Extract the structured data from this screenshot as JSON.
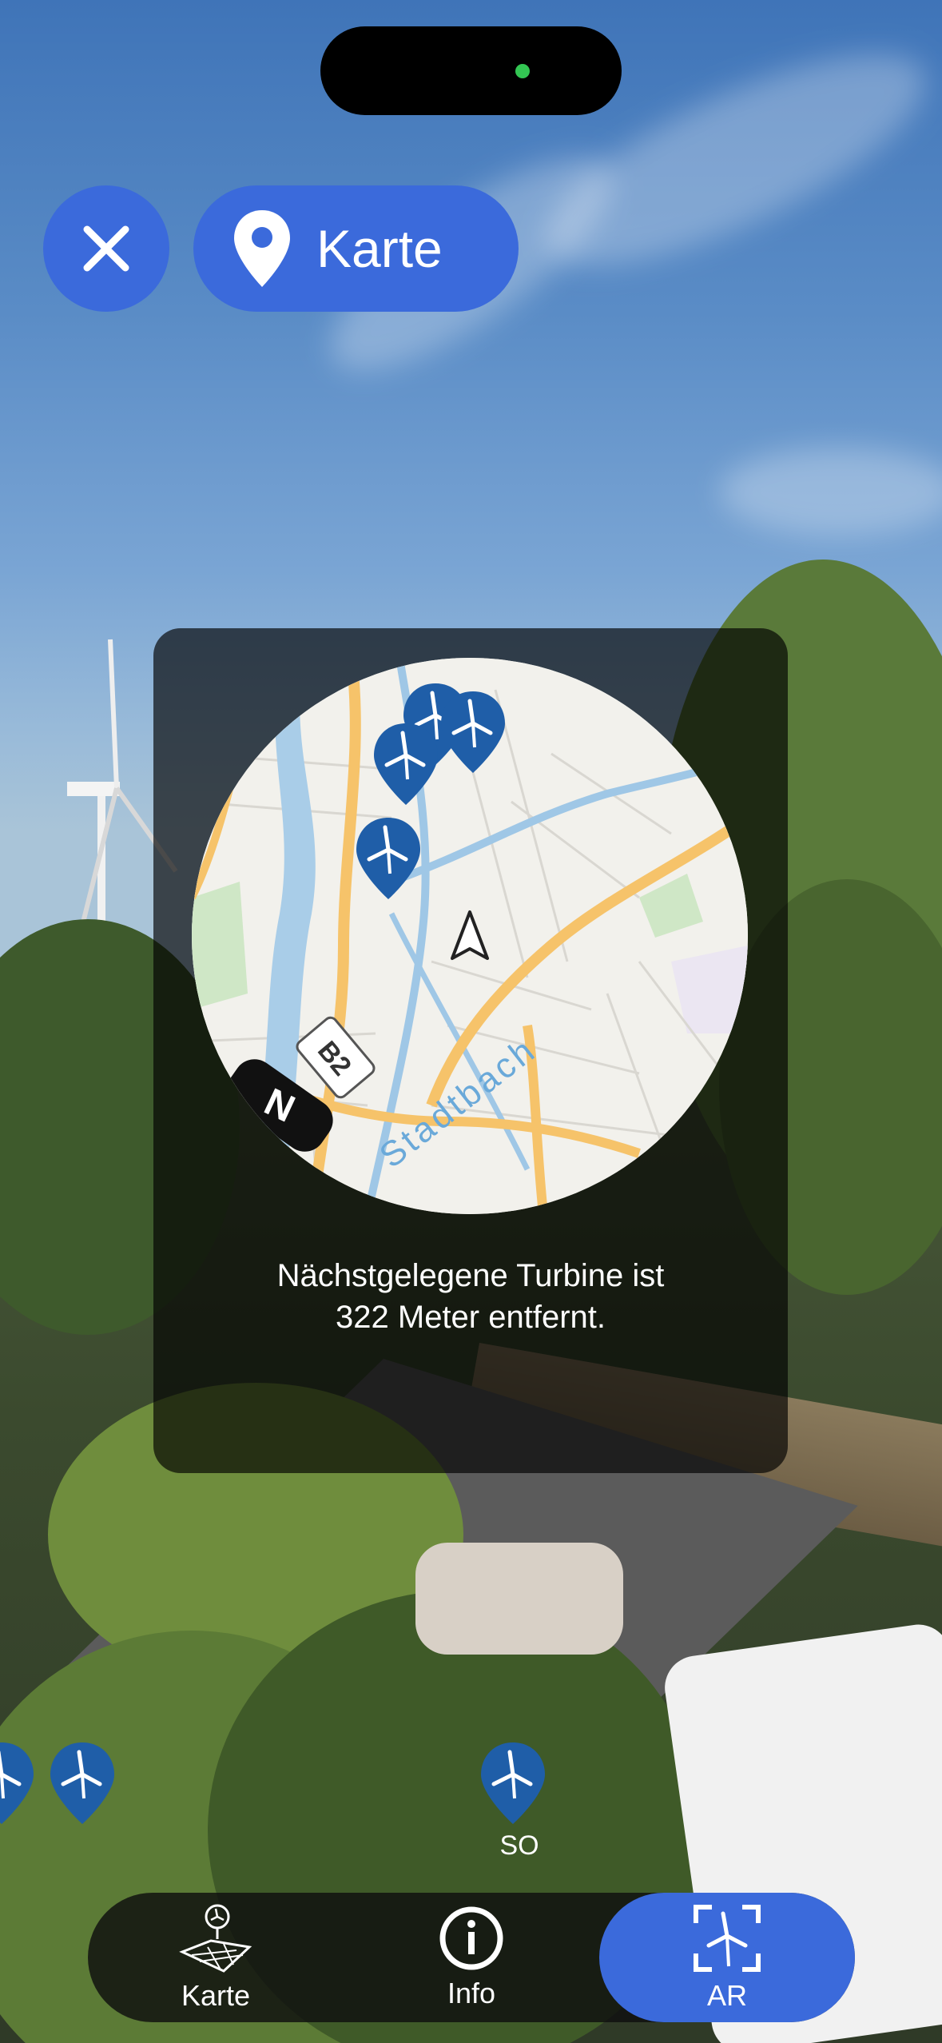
{
  "top_bar": {
    "close_icon": "close-icon",
    "map_button_label": "Karte",
    "map_icon": "map-pin-icon"
  },
  "minimap": {
    "road_label_b2": "B2",
    "stream_label": "Stadtbach",
    "compass_label": "N",
    "turbine_marker_count": 4,
    "user_icon": "navigation-arrow-icon"
  },
  "info_text_line1": "Nächstgelegene Turbine ist",
  "info_text_line2": "322 Meter entfernt.",
  "ar_markers": {
    "direction_label": "SO"
  },
  "tab_bar": {
    "tabs": [
      {
        "label": "Karte",
        "icon": "map-turbine-icon",
        "selected": false
      },
      {
        "label": "Info",
        "icon": "info-icon",
        "selected": false
      },
      {
        "label": "AR",
        "icon": "ar-scan-turbine-icon",
        "selected": true
      }
    ]
  },
  "colors": {
    "accent": "#3b6adb",
    "marker": "#1f5ea8",
    "panel": "rgba(0,0,0,0.66)"
  }
}
